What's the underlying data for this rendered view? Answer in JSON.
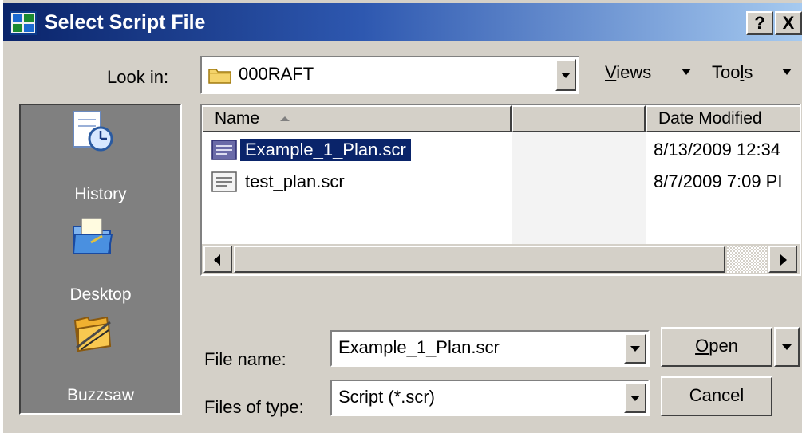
{
  "window": {
    "title": "Select Script File",
    "help_glyph": "?",
    "close_glyph": "X"
  },
  "look_in": {
    "label": "Look in:",
    "value": "000RAFT"
  },
  "toolbar": {
    "views_label_underlined": "V",
    "views_label_rest": "iews",
    "tools_label_prefix": "Too",
    "tools_label_underlined": "l",
    "tools_label_rest": "s"
  },
  "places": [
    {
      "label": "History",
      "icon": "history-icon"
    },
    {
      "label": "Desktop",
      "icon": "desktop-icon"
    },
    {
      "label": "Buzzsaw",
      "icon": "buzzsaw-icon"
    }
  ],
  "file_list": {
    "columns": [
      "Name",
      "",
      "Date Modified"
    ],
    "files": [
      {
        "name": "Example_1_Plan.scr",
        "date": "8/13/2009 12:34",
        "selected": true
      },
      {
        "name": "test_plan.scr",
        "date": "8/7/2009 7:09 PI",
        "selected": false
      }
    ]
  },
  "file_name": {
    "label": "File name:",
    "value": "Example_1_Plan.scr"
  },
  "file_type": {
    "label": "Files of type:",
    "value": "Script (*.scr)"
  },
  "buttons": {
    "open_underlined": "O",
    "open_rest": "pen",
    "cancel": "Cancel"
  },
  "colors": {
    "title_bar_start": "#0a246a",
    "title_bar_end": "#a6caf0",
    "dialog_face": "#d4d0c8",
    "places_bar": "#808080",
    "selection": "#0a246a"
  }
}
